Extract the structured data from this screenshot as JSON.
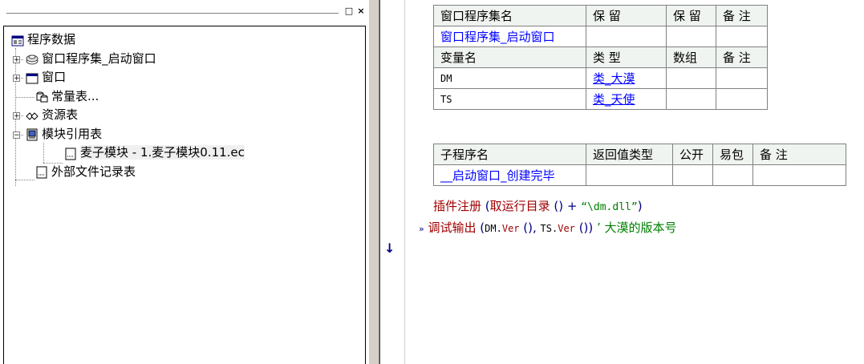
{
  "left_panel": {
    "title_buttons": {
      "restore": "□",
      "close": "×"
    },
    "tree": [
      {
        "label": "程序数据",
        "icon": "program-data-icon",
        "level": 0
      },
      {
        "label": "窗口程序集_启动窗口",
        "icon": "assembly-icon",
        "level": 1,
        "expand": "⊞"
      },
      {
        "label": "窗口",
        "icon": "window-icon",
        "level": 1,
        "expand": "⊞"
      },
      {
        "label": "常量表...",
        "icon": "constant-icon",
        "level": 1
      },
      {
        "label": "资源表",
        "icon": "resource-icon",
        "level": 1,
        "expand": "⊞"
      },
      {
        "label": "模块引用表",
        "icon": "module-ref-icon",
        "level": 1,
        "expand": "⊟"
      },
      {
        "label": "麦子模块 - 1.麦子模块0.11.ec",
        "icon": "module-file-icon",
        "level": 2
      },
      {
        "label": "外部文件记录表",
        "icon": "file-record-icon",
        "level": 1
      }
    ]
  },
  "code": {
    "assembly_table": {
      "headers": [
        "窗口程序集名",
        "保 留",
        "保 留",
        "备 注"
      ],
      "row": [
        "窗口程序集_启动窗口",
        "",
        "",
        ""
      ]
    },
    "var_table": {
      "headers": [
        "变量名",
        "类 型",
        "数组",
        "备 注"
      ],
      "rows": [
        [
          "DM",
          "类_大漠",
          "",
          ""
        ],
        [
          "TS",
          "类_天使",
          "",
          ""
        ]
      ]
    },
    "sub_table": {
      "headers": [
        "子程序名",
        "返回值类型",
        "公开",
        "易包",
        "备 注"
      ],
      "row": [
        "__启动窗口_创建完毕",
        "",
        "",
        "",
        ""
      ]
    },
    "lines": [
      {
        "marker": "",
        "cmd": "插件注册",
        "open": " (",
        "arg1": "取运行目录",
        "arg1b": " () + ",
        "str": "“\\dm.dll”",
        "close": ")"
      },
      {
        "marker": "»",
        "cmd": "调试输出",
        "open": " (",
        "a1": "DM.",
        "a1m": "Ver",
        "a1p": " (), ",
        "a2": "TS.",
        "a2m": "Ver",
        "a2p": " ())",
        "comment": " ’ 大漠的版本号"
      }
    ],
    "gutter_arrow": "↓"
  }
}
